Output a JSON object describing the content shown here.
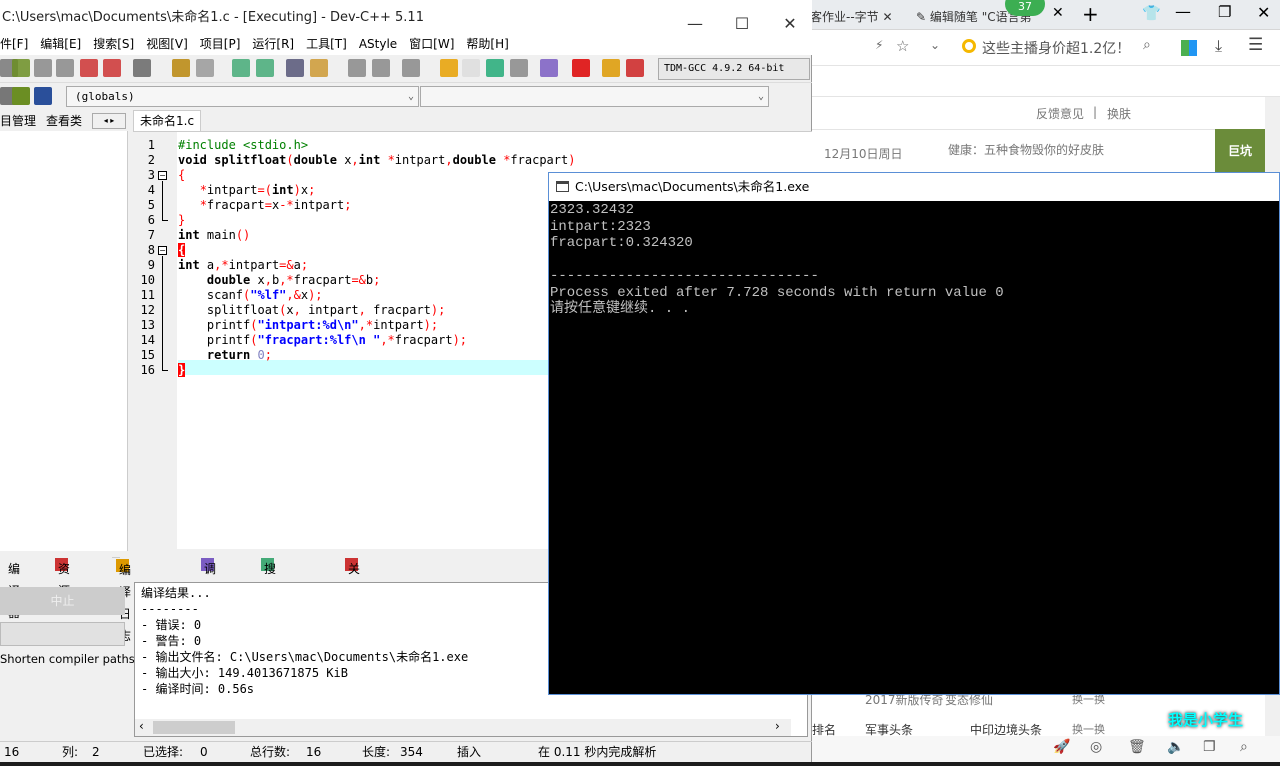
{
  "browser": {
    "tabs": [
      "客作业--字节",
      "编辑随笔 \"C语言第"
    ],
    "badge": "37",
    "address_text": "这些主播身价超1.2亿！",
    "links": [
      "反馈意见",
      "换肤"
    ],
    "date": "12月10日周日",
    "headline": "健康：五种食物毁你的好皮肤",
    "ad_text": "巨坑",
    "row1": [
      "2017新版传奇",
      "变态修仙",
      "换一换"
    ],
    "row2": [
      "排名",
      "军事头条",
      "中印边境头条",
      "换一换"
    ],
    "mascot_text": "我是小学生"
  },
  "dev": {
    "title": "C:\\Users\\mac\\Documents\\未命名1.c - [Executing] - Dev-C++ 5.11",
    "menu": [
      "件[F]",
      "编辑[E]",
      "搜索[S]",
      "视图[V]",
      "项目[P]",
      "运行[R]",
      "工具[T]",
      "AStyle",
      "窗口[W]",
      "帮助[H]"
    ],
    "compiler": "TDM-GCC 4.9.2 64-bit",
    "scope_combo": "(globals)",
    "left_tabs": [
      "目管理",
      "查看类"
    ],
    "file_tab": "未命名1.c",
    "code": [
      [
        [
          "#include <stdio.h>",
          "pp"
        ]
      ],
      [
        [
          "void ",
          "kw"
        ],
        [
          "splitfloat",
          "kw"
        ],
        [
          "(",
          "op"
        ],
        [
          "double ",
          "kw"
        ],
        [
          "x",
          "id"
        ],
        [
          ",",
          "op"
        ],
        [
          "int ",
          "kw"
        ],
        [
          "*",
          "op"
        ],
        [
          "intpart",
          "id"
        ],
        [
          ",",
          "op"
        ],
        [
          "double ",
          "kw"
        ],
        [
          "*",
          "op"
        ],
        [
          "fracpart",
          "id"
        ],
        [
          ")",
          "op"
        ]
      ],
      [
        [
          "{",
          "op"
        ]
      ],
      [
        [
          "   ",
          ""
        ],
        [
          "*",
          "op"
        ],
        [
          "intpart",
          "id"
        ],
        [
          "=(",
          "op"
        ],
        [
          "int",
          "kw"
        ],
        [
          ")",
          "op"
        ],
        [
          "x",
          "id"
        ],
        [
          ";",
          "op"
        ]
      ],
      [
        [
          "   ",
          ""
        ],
        [
          "*",
          "op"
        ],
        [
          "fracpart",
          "id"
        ],
        [
          "=",
          "op"
        ],
        [
          "x",
          "id"
        ],
        [
          "-*",
          "op"
        ],
        [
          "intpart",
          "id"
        ],
        [
          ";",
          "op"
        ]
      ],
      [
        [
          "}",
          "op"
        ]
      ],
      [
        [
          "int ",
          "kw"
        ],
        [
          "main",
          "id"
        ],
        [
          "()",
          "op"
        ]
      ],
      [
        [
          "{",
          "br"
        ]
      ],
      [
        [
          "int ",
          "kw"
        ],
        [
          "a",
          "id"
        ],
        [
          ",*",
          "op"
        ],
        [
          "intpart",
          "id"
        ],
        [
          "=&",
          "op"
        ],
        [
          "a",
          "id"
        ],
        [
          ";",
          "op"
        ]
      ],
      [
        [
          "    double ",
          "kw"
        ],
        [
          "x",
          "id"
        ],
        [
          ",",
          "op"
        ],
        [
          "b",
          "id"
        ],
        [
          ",*",
          "op"
        ],
        [
          "fracpart",
          "id"
        ],
        [
          "=&",
          "op"
        ],
        [
          "b",
          "id"
        ],
        [
          ";",
          "op"
        ]
      ],
      [
        [
          "    scanf",
          "id"
        ],
        [
          "(",
          "op"
        ],
        [
          "\"%lf\"",
          "str"
        ],
        [
          ",&",
          "op"
        ],
        [
          "x",
          "id"
        ],
        [
          ");",
          "op"
        ]
      ],
      [
        [
          "    splitfloat",
          "id"
        ],
        [
          "(",
          "op"
        ],
        [
          "x",
          "id"
        ],
        [
          ", ",
          "op"
        ],
        [
          "intpart",
          "id"
        ],
        [
          ", ",
          "op"
        ],
        [
          "fracpart",
          "id"
        ],
        [
          ");",
          "op"
        ]
      ],
      [
        [
          "    printf",
          "id"
        ],
        [
          "(",
          "op"
        ],
        [
          "\"intpart:%d\\n\"",
          "str"
        ],
        [
          ",*",
          "op"
        ],
        [
          "intpart",
          "id"
        ],
        [
          ");",
          "op"
        ]
      ],
      [
        [
          "    printf",
          "id"
        ],
        [
          "(",
          "op"
        ],
        [
          "\"fracpart:%lf\\n \"",
          "str"
        ],
        [
          ",*",
          "op"
        ],
        [
          "fracpart",
          "id"
        ],
        [
          ");",
          "op"
        ]
      ],
      [
        [
          "    return ",
          "kw"
        ],
        [
          "0",
          "num"
        ],
        [
          ";",
          "op"
        ]
      ],
      [
        [
          "}",
          "br"
        ]
      ]
    ],
    "bottom_tabs": [
      "编译器",
      "资源",
      "编译日志",
      "调试",
      "搜索结果",
      "关闭"
    ],
    "stop_button": "中止",
    "shorten_label": "Shorten compiler paths",
    "log": [
      "编译结果...",
      "--------",
      "- 错误: 0",
      "- 警告: 0",
      "- 输出文件名: C:\\Users\\mac\\Documents\\未命名1.exe",
      "- 输出大小: 149.4013671875 KiB",
      "- 编译时间: 0.56s"
    ],
    "status": {
      "line": "16",
      "col_label": "列:",
      "col": "2",
      "sel_label": "已选择:",
      "sel": "0",
      "total_label": "总行数:",
      "total": "16",
      "len_label": "长度:",
      "len": "354",
      "mode": "插入",
      "parse": "在 0.11 秒内完成解析"
    }
  },
  "console": {
    "title": "C:\\Users\\mac\\Documents\\未命名1.exe",
    "lines": [
      "2323.32432",
      "intpart:2323",
      "fracpart:0.324320",
      "",
      "--------------------------------",
      "Process exited after 7.728 seconds with return value 0",
      "请按任意键继续. . ."
    ]
  }
}
